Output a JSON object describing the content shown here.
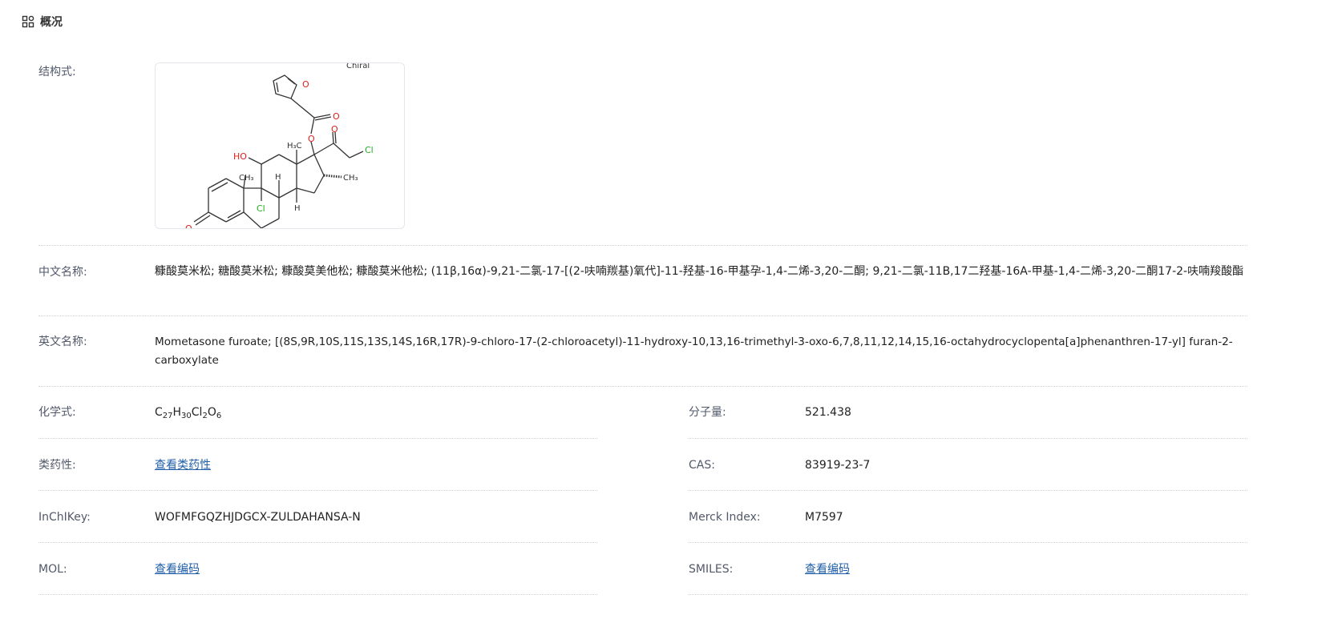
{
  "header": {
    "title": "概况",
    "icon": "grid-apps-icon"
  },
  "structure": {
    "label": "结构式:",
    "chiral_label": "Chiral",
    "atoms": {
      "o_ring": "O",
      "o_carbonyl_1": "O",
      "o_ester": "O",
      "o_carbonyl_2": "O",
      "cl_side": "Cl",
      "h3c_top": "H₃C",
      "ho": "HO",
      "ch3_16": "CH₃",
      "ch3_10": "CH₃",
      "h_8": "H",
      "cl_9": "Cl",
      "h_14": "H",
      "o_3": "O"
    }
  },
  "chinese_name": {
    "label": "中文名称:",
    "value": "糠酸莫米松; 糖酸莫米松; 糠酸莫美他松; 糠酸莫米他松; (11β,16α)-9,21-二氯-17-[(2-呋喃羰基)氧代]-11-羟基-16-甲基孕-1,4-二烯-3,20-二酮; 9,21-二氯-11B,17二羟基-16A-甲基-1,4-二烯-3,20-二酮17-2-呋喃羧酸酯"
  },
  "english_name": {
    "label": "英文名称:",
    "value": "Mometasone furoate; [(8S,9R,10S,11S,13S,14S,16R,17R)-9-chloro-17-(2-chloroacetyl)-11-hydroxy-10,13,16-trimethyl-3-oxo-6,7,8,11,12,14,15,16-octahydrocyclopenta[a]phenanthren-17-yl] furan-2-carboxylate"
  },
  "formula": {
    "label": "化学式:",
    "parts": [
      "C",
      "27",
      "H",
      "30",
      "Cl",
      "2",
      "O",
      "6"
    ]
  },
  "molecular_weight": {
    "label": "分子量:",
    "value": "521.438"
  },
  "druglikeness": {
    "label": "类药性:",
    "link": "查看类药性"
  },
  "cas": {
    "label": "CAS:",
    "value": "83919-23-7"
  },
  "inchikey": {
    "label": "InChIKey:",
    "value": "WOFMFGQZHJDGCX-ZULDAHANSA-N"
  },
  "merck": {
    "label": "Merck Index:",
    "value": "M7597"
  },
  "mol": {
    "label": "MOL:",
    "link": "查看编码"
  },
  "smiles": {
    "label": "SMILES:",
    "link": "查看编码"
  },
  "colors": {
    "link": "#1f5ea8",
    "label": "#52596a",
    "oxygen": "#e0201b",
    "chlorine": "#22b022"
  }
}
